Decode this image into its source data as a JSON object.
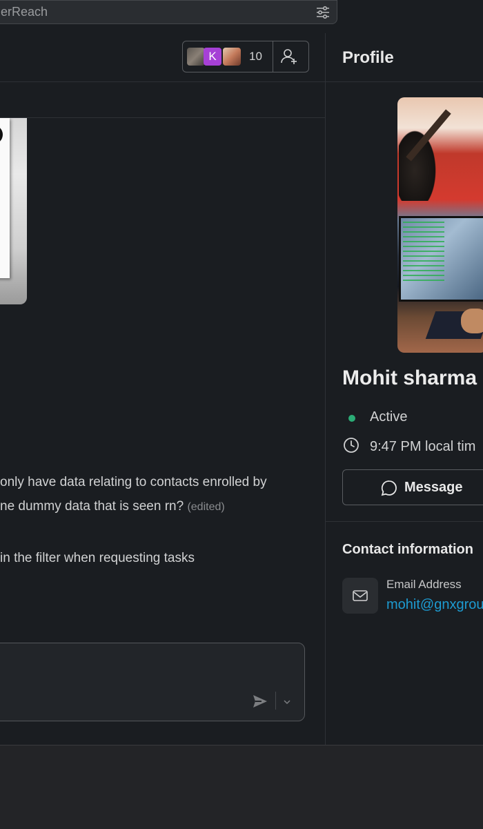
{
  "search": {
    "text": "erReach"
  },
  "header": {
    "member_count": "10",
    "avatar_initial": "K"
  },
  "messages": {
    "line1": "only have data relating to contacts enrolled by",
    "line2": "ne dummy data that is seen rn?",
    "edited": "(edited)",
    "line3": "in the filter when requesting tasks"
  },
  "profile": {
    "title": "Profile",
    "name": "Mohit sharma",
    "status": "Active",
    "local_time": "9:47 PM local tim",
    "message_button": "Message",
    "contact_title": "Contact information",
    "email_label": "Email Address",
    "email_value": "mohit@gnxgrou"
  },
  "colors": {
    "accent": "#1d9bd1",
    "active": "#2bac76",
    "background": "#1a1d21"
  }
}
